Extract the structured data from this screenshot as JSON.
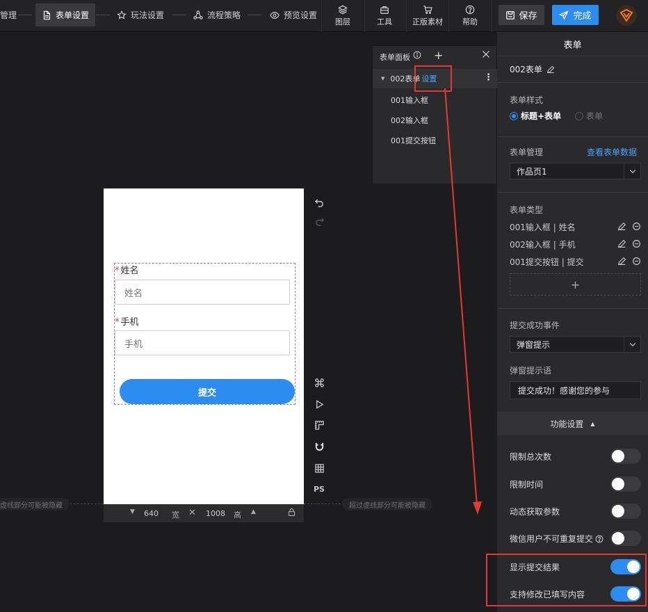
{
  "steps": [
    {
      "label": "管理"
    },
    {
      "label": "表单设置"
    },
    {
      "label": "玩法设置"
    },
    {
      "label": "流程策略"
    },
    {
      "label": "预览设置"
    }
  ],
  "tools": [
    {
      "label": "图层",
      "icon": "layers-icon"
    },
    {
      "label": "工具",
      "icon": "toolbox-icon"
    },
    {
      "label": "正版素材",
      "icon": "cart-icon"
    },
    {
      "label": "帮助",
      "icon": "help-icon"
    }
  ],
  "save_label": "保存",
  "done_label": "完成",
  "canvas": {
    "field1_label": "姓名",
    "field1_placeholder": "姓名",
    "field2_label": "手机",
    "field2_placeholder": "手机",
    "required_mark": "*",
    "submit_label": "提交",
    "width": "640",
    "width_unit": "宽",
    "height": "1008",
    "height_unit": "高",
    "hidden_note_left": "虚线部分可能被隐藏",
    "hidden_note_right": "超过虚线部分可能被隐藏",
    "ps_label": "PS"
  },
  "layer_panel": {
    "title": "表单面板",
    "root": "002表单",
    "root_action": "设置",
    "children": [
      "001输入框",
      "002输入框",
      "001提交按钮"
    ]
  },
  "right_panel": {
    "title": "表单",
    "form_name": "002表单",
    "style_label": "表单样式",
    "style_options": [
      "标题+表单",
      "表单"
    ],
    "style_selected": "标题+表单",
    "manage_label": "表单管理",
    "manage_link": "查看表单数据",
    "manage_select": "作品页1",
    "type_label": "表单类型",
    "type_items": [
      "001输入框 | 姓名",
      "002输入框 | 手机",
      "001提交按钮 | 提交"
    ],
    "success_event_label": "提交成功事件",
    "success_event_select": "弹窗提示",
    "popup_text_label": "弹窗提示语",
    "popup_text_value": "提交成功！感谢您的参与",
    "features_title": "功能设置",
    "toggles": [
      {
        "label": "限制总次数",
        "on": false
      },
      {
        "label": "限制时间",
        "on": false
      },
      {
        "label": "动态获取参数",
        "on": false
      },
      {
        "label": "微信用户不可重复提交",
        "on": false
      },
      {
        "label": "显示提交结果",
        "on": true
      },
      {
        "label": "支持修改已填写内容",
        "on": true
      }
    ]
  },
  "colors": {
    "accent": "#2d8cf0",
    "highlight": "#e53935"
  }
}
